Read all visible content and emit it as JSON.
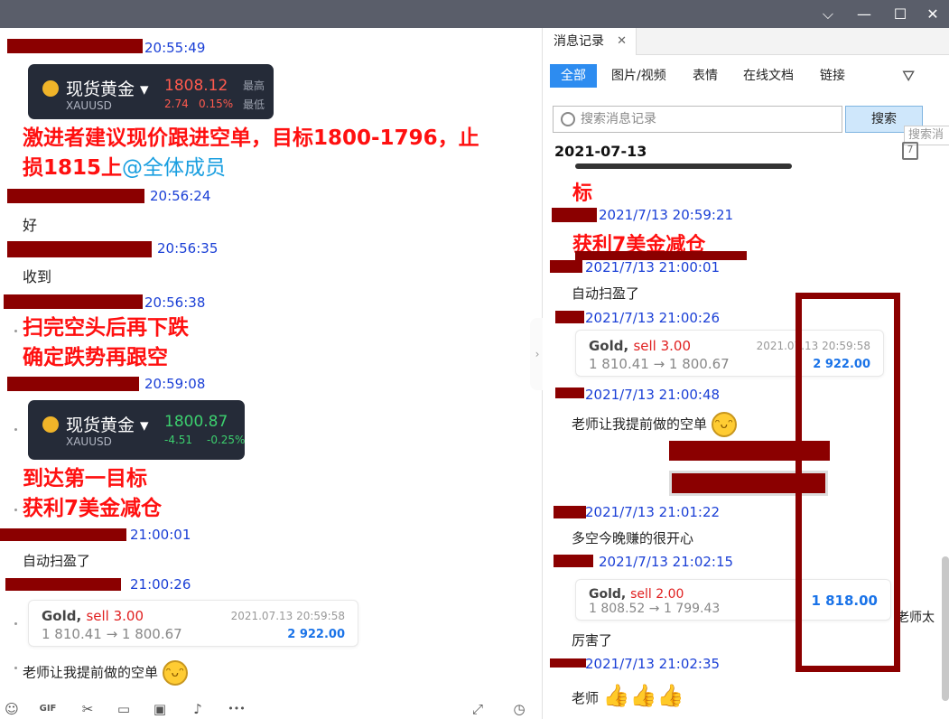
{
  "window": {
    "controls": {
      "chevron": "⌵",
      "minimize": "—",
      "maximize": "☐",
      "close": "✕"
    }
  },
  "left": {
    "messages": {
      "m1_time": "20:55:49",
      "quote1": {
        "name": "现货黄金",
        "code": "XAUUSD",
        "price": "1808.12",
        "change": "2.74",
        "pct": "0.15%",
        "high": "最高",
        "low": "最低",
        "price_color": "#ff5a4e"
      },
      "big1_line1": "激进者建议现价跟进空单，目标1800-1796，止",
      "big1_line2": "损1815上",
      "big1_mention": "@全体成员",
      "m2_time": "20:56:24",
      "m2_text": "好",
      "m3_time": "20:56:35",
      "m3_text": "收到",
      "m4_time": "20:56:38",
      "big2_line1": "扫完空头后再下跌",
      "big2_line2": "确定跌势再跟空",
      "m5_time": "20:59:08",
      "quote2": {
        "name": "现货黄金",
        "code": "XAUUSD",
        "price": "1800.87",
        "change": "-4.51",
        "pct": "-0.25%",
        "price_color": "#3ccf6e"
      },
      "big3_line1": "到达第一目标",
      "big3_line2": "获利7美金减仓",
      "m6_time": "21:00:01",
      "m6_text": "自动扫盈了",
      "m7_time": "21:00:26",
      "trade": {
        "symbol": "Gold,",
        "side": "sell 3.00",
        "prices": "1 810.41 → 1 800.67",
        "date": "2021.07.13 20:59:58",
        "profit": "2 922.00"
      },
      "m8_text": "老师让我提前做的空单"
    },
    "toolbar": [
      {
        "name": "emoji-icon",
        "glyph": "☺"
      },
      {
        "name": "gif-icon",
        "glyph": "GIF"
      },
      {
        "name": "scissors-icon",
        "glyph": "✂"
      },
      {
        "name": "folder-icon",
        "glyph": "▭"
      },
      {
        "name": "image-icon",
        "glyph": "▣"
      },
      {
        "name": "bell-icon",
        "glyph": "♪"
      },
      {
        "name": "more-icon",
        "glyph": "•••"
      },
      {
        "name": "expand-icon",
        "glyph": "⤢"
      },
      {
        "name": "history-icon",
        "glyph": "◷"
      }
    ]
  },
  "right": {
    "tab_title": "消息记录",
    "filters": [
      "全部",
      "图片/视频",
      "表情",
      "在线文档",
      "链接"
    ],
    "search": {
      "placeholder": "搜索消息记录",
      "button": "搜索",
      "tip": "搜索消"
    },
    "date_header": "2021-07-13",
    "calendar_label": "7",
    "messages": {
      "r_big_top": "标",
      "r1_time": "2021/7/13 20:59:21",
      "r_big_1": "获利7美金减仓",
      "r2_time": "2021/7/13 21:00:01",
      "r2_text": "自动扫盈了",
      "r3_time": "2021/7/13 21:00:26",
      "trade1": {
        "symbol": "Gold,",
        "side": "sell 3.00",
        "prices": "1 810.41 → 1 800.67",
        "date": "2021.07.13 20:59:58",
        "profit": "2 922.00"
      },
      "r4_time": "2021/7/13 21:00:48",
      "r4_text": "老师让我提前做的空单",
      "r5_time": "2021/7/13 21:01:22",
      "r5_text": "多空今晚赚的很开心",
      "r6_time": "2021/7/13 21:02:15",
      "trade2": {
        "symbol": "Gold,",
        "side": "sell 2.00",
        "prices": "1 808.52 → 1 799.43",
        "profit": "1 818.00"
      },
      "r6_side_text": "老师太",
      "r6_text": "厉害了",
      "r7_time": "2021/7/13 21:02:35",
      "r7_text": "老师"
    }
  }
}
